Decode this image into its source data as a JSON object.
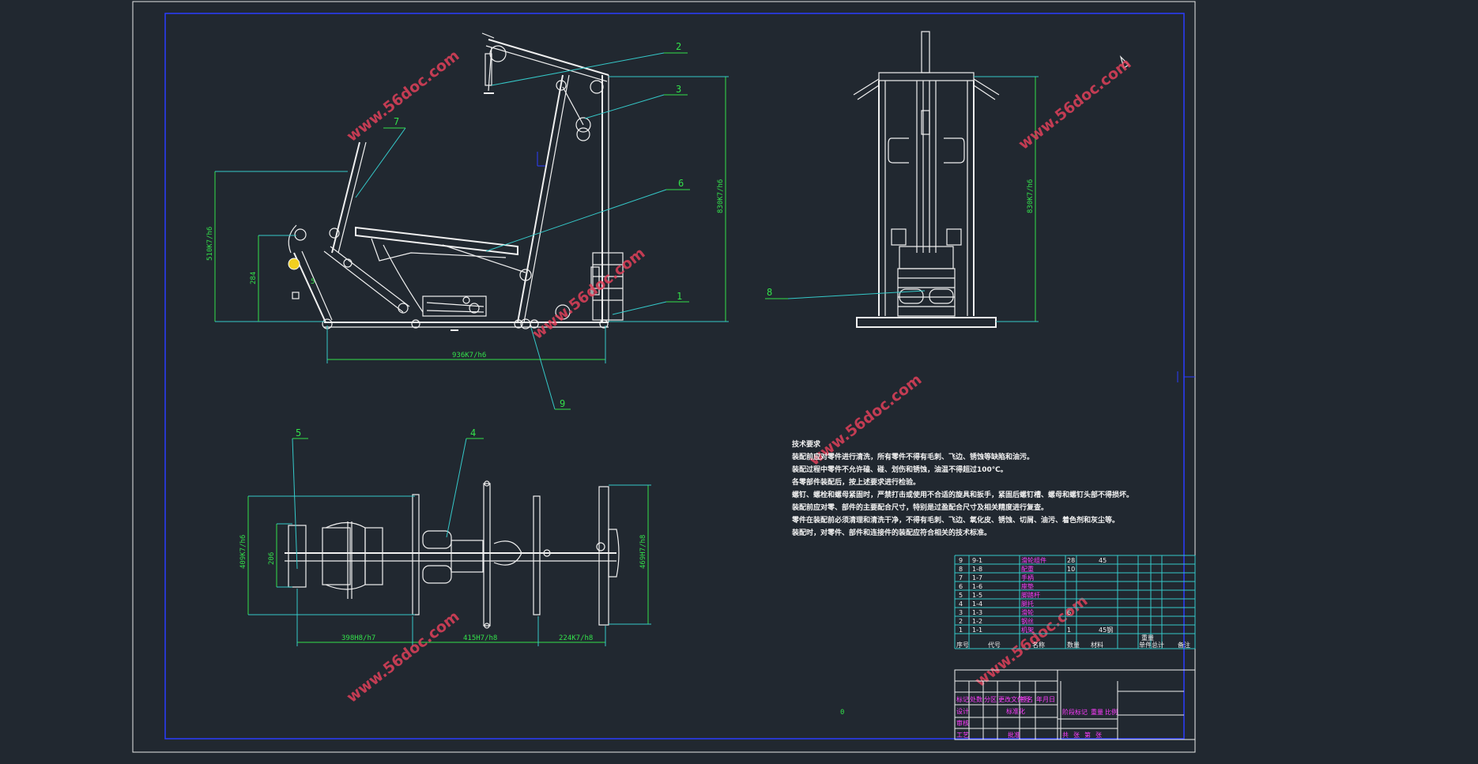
{
  "drawing": {
    "balloons": [
      {
        "num": "1"
      },
      {
        "num": "2"
      },
      {
        "num": "3"
      },
      {
        "num": "4"
      },
      {
        "num": "5"
      },
      {
        "num": "6"
      },
      {
        "num": "7"
      },
      {
        "num": "8"
      },
      {
        "num": "9"
      }
    ],
    "dimensions": {
      "side_height": "830K7/h6",
      "side_left_height": "510K7/h6",
      "side_left_small": "284",
      "side_base": "936K7/h6",
      "front_height": "830K7/h6",
      "plan_left_height": "409K7/h6",
      "plan_left_small": "206",
      "plan_right_height": "469H7/h8",
      "plan_seg1": "398H8/h7",
      "plan_seg2": "415H7/h8",
      "plan_seg3": "224K7/h8"
    },
    "watermark": "www.56doc.com",
    "center_mark": "0"
  },
  "notes": {
    "title": "技术要求",
    "lines": [
      "装配前应对零件进行清洗，所有零件不得有毛刺、飞边、锈蚀等缺陷和油污。",
      "装配过程中零件不允许磕、碰、划伤和锈蚀，油温不得超过100℃。",
      "各零部件装配后，按上述要求进行检验。",
      "螺钉、螺栓和螺母紧固时，严禁打击或使用不合适的旋具和扳手，紧固后螺钉槽、螺母和螺钉头部不得损坏。",
      "装配前应对零、部件的主要配合尺寸，特别是过盈配合尺寸及相关精度进行复查。",
      "零件在装配前必须清理和清洗干净，不得有毛刺、飞边、氧化皮、锈蚀、切屑、油污、着色剂和灰尘等。",
      "装配时，对零件、部件和连接件的装配应符合相关的技术标准。"
    ]
  },
  "parts_table": {
    "rows": [
      {
        "seq": "9",
        "code": "9-1",
        "name": "滑轮组件",
        "qty": "28",
        "mat": "45"
      },
      {
        "seq": "8",
        "code": "1-8",
        "name": "配重",
        "qty": "10",
        "mat": ""
      },
      {
        "seq": "7",
        "code": "1-7",
        "name": "手柄",
        "qty": "",
        "mat": ""
      },
      {
        "seq": "6",
        "code": "1-6",
        "name": "座垫",
        "qty": "",
        "mat": ""
      },
      {
        "seq": "5",
        "code": "1-5",
        "name": "脚踏杆",
        "qty": "",
        "mat": ""
      },
      {
        "seq": "4",
        "code": "1-4",
        "name": "腿托",
        "qty": "",
        "mat": ""
      },
      {
        "seq": "3",
        "code": "1-3",
        "name": "滑轮",
        "qty": "6",
        "mat": ""
      },
      {
        "seq": "2",
        "code": "1-2",
        "name": "钢丝",
        "qty": "",
        "mat": ""
      },
      {
        "seq": "1",
        "code": "1-1",
        "name": "机架",
        "qty": "1",
        "mat": "45钢"
      }
    ],
    "header": [
      "序号",
      "代号",
      "名称",
      "数量",
      "材料",
      "单件",
      "总计",
      "备注"
    ],
    "header_sub": [
      "重量"
    ]
  },
  "title_block": {
    "row1": [
      "标记",
      "处数",
      "分区",
      "更改文件号",
      "签名",
      "年月日"
    ],
    "row2": [
      "设计",
      "",
      "",
      "标准化"
    ],
    "row3": [
      "审核"
    ],
    "row4": [
      "工艺",
      "",
      "",
      "批准"
    ],
    "stage": [
      "阶段标记",
      "重量",
      "比例"
    ],
    "sheet": [
      "共",
      "张",
      "第",
      "张"
    ]
  }
}
